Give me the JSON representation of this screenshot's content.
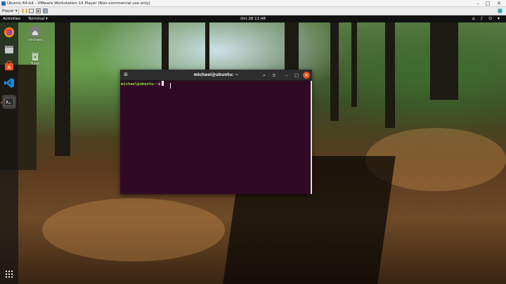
{
  "vm_window": {
    "title": "Ubuntu 64-bit - VMware Workstation 15 Player (Non-commercial use only)",
    "minimize": "–",
    "maximize": "□",
    "close": "✕"
  },
  "vm_toolbar": {
    "player_menu": "Player ▾",
    "pause": "❚❚",
    "icons": [
      "vm-settings-icon",
      "fullscreen-icon",
      "unity-icon"
    ]
  },
  "gnome_topbar": {
    "activities": "Activities",
    "app_menu": "Terminal ▾",
    "clock": "Oct 28  11:48",
    "tray": "⌂ ♪ ⏻ ▾"
  },
  "dock": {
    "items": [
      {
        "name": "firefox",
        "icon": "firefox-icon"
      },
      {
        "name": "files",
        "icon": "files-icon"
      },
      {
        "name": "software",
        "icon": "software-icon"
      },
      {
        "name": "vscode",
        "icon": "vscode-icon"
      },
      {
        "name": "terminal",
        "icon": "terminal-icon",
        "active": true
      }
    ],
    "show_apps": "⋮⋮⋮"
  },
  "desktop_icons": [
    {
      "label": "michael",
      "icon": "home-folder-icon"
    },
    {
      "label": "Trash",
      "icon": "trash-icon"
    }
  ],
  "terminal": {
    "title": "michael@ubuntu: ~",
    "new_tab": "⊞",
    "search": "⌕",
    "menu": "≡",
    "minimize": "–",
    "maximize": "□",
    "close": "✕",
    "prompt_user": "michael@ubuntu",
    "prompt_sep": ":",
    "prompt_path": "~",
    "prompt_symbol": "$"
  },
  "colors": {
    "terminal_bg": "#300a24",
    "prompt_user": "#8ae234",
    "prompt_path": "#729fcf",
    "ubuntu_orange": "#e95420"
  }
}
